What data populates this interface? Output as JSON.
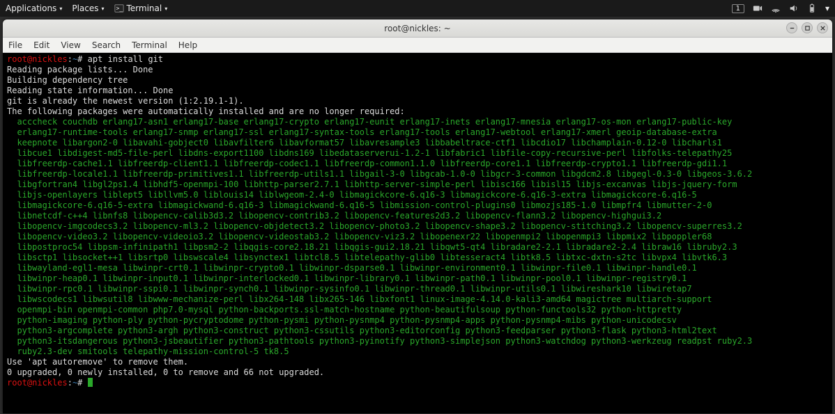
{
  "topbar": {
    "applications": "Applications",
    "places": "Places",
    "terminal": "Terminal",
    "workspace": "1"
  },
  "window": {
    "title": "root@nickles: ~"
  },
  "menubar": {
    "file": "File",
    "edit": "Edit",
    "view": "View",
    "search": "Search",
    "terminal": "Terminal",
    "help": "Help"
  },
  "prompt": {
    "userhost": "root@nickles",
    "sep": ":",
    "cwd": "~",
    "sigil": "#"
  },
  "term": {
    "cmd1": "apt install git",
    "l1": "Reading package lists... Done",
    "l2": "Building dependency tree",
    "l3": "Reading state information... Done",
    "l4": "git is already the newest version (1:2.19.1-1).",
    "l5": "The following packages were automatically installed and are no longer required:",
    "pkg": "  acccheck couchdb erlang17-asn1 erlang17-base erlang17-crypto erlang17-eunit erlang17-inets erlang17-mnesia erlang17-os-mon erlang17-public-key\n  erlang17-runtime-tools erlang17-snmp erlang17-ssl erlang17-syntax-tools erlang17-tools erlang17-webtool erlang17-xmerl geoip-database-extra\n  keepnote libargon2-0 libavahi-gobject0 libavfilter6 libavformat57 libavresample3 libbabeltrace-ctf1 libcdio17 libchamplain-0.12-0 libcharls1\n  libcue1 libdigest-md5-file-perl libdns-export1100 libdns169 libedataserverui-1.2-1 libfabric1 libfile-copy-recursive-perl libfolks-telepathy25\n  libfreerdp-cache1.1 libfreerdp-client1.1 libfreerdp-codec1.1 libfreerdp-common1.1.0 libfreerdp-core1.1 libfreerdp-crypto1.1 libfreerdp-gdi1.1\n  libfreerdp-locale1.1 libfreerdp-primitives1.1 libfreerdp-utils1.1 libgail-3-0 libgcab-1.0-0 libgcr-3-common libgdcm2.8 libgegl-0.3-0 libgeos-3.6.2\n  libgfortran4 libgl2ps1.4 libhdf5-openmpi-100 libhttp-parser2.7.1 libhttp-server-simple-perl libisc166 libisl15 libjs-excanvas libjs-jquery-form\n  libjs-openlayers liblept5 libllvm5.0 liblouis14 liblwgeom-2.4-0 libmagickcore-6.q16-3 libmagickcore-6.q16-3-extra libmagickcore-6.q16-5\n  libmagickcore-6.q16-5-extra libmagickwand-6.q16-3 libmagickwand-6.q16-5 libmission-control-plugins0 libmozjs185-1.0 libmpfr4 libmutter-2-0\n  libnetcdf-c++4 libnfs8 libopencv-calib3d3.2 libopencv-contrib3.2 libopencv-features2d3.2 libopencv-flann3.2 libopencv-highgui3.2\n  libopencv-imgcodecs3.2 libopencv-ml3.2 libopencv-objdetect3.2 libopencv-photo3.2 libopencv-shape3.2 libopencv-stitching3.2 libopencv-superres3.2\n  libopencv-video3.2 libopencv-videoio3.2 libopencv-videostab3.2 libopencv-viz3.2 libopenexr22 libopenmpi2 libopenmpi3 libpmix2 libpoppler68\n  libpostproc54 libpsm-infinipath1 libpsm2-2 libqgis-core2.18.21 libqgis-gui2.18.21 libqwt5-qt4 libradare2-2.1 libradare2-2.4 libraw16 libruby2.3\n  libsctp1 libsocket++1 libsrtp0 libswscale4 libsynctex1 libtcl8.5 libtelepathy-glib0 libtesseract4 libtk8.5 libtxc-dxtn-s2tc libvpx4 libvtk6.3\n  libwayland-egl1-mesa libwinpr-crt0.1 libwinpr-crypto0.1 libwinpr-dsparse0.1 libwinpr-environment0.1 libwinpr-file0.1 libwinpr-handle0.1\n  libwinpr-heap0.1 libwinpr-input0.1 libwinpr-interlocked0.1 libwinpr-library0.1 libwinpr-path0.1 libwinpr-pool0.1 libwinpr-registry0.1\n  libwinpr-rpc0.1 libwinpr-sspi0.1 libwinpr-synch0.1 libwinpr-sysinfo0.1 libwinpr-thread0.1 libwinpr-utils0.1 libwireshark10 libwiretap7\n  libwscodecs1 libwsutil8 libwww-mechanize-perl libx264-148 libx265-146 libxfont1 linux-image-4.14.0-kali3-amd64 magictree multiarch-support\n  openmpi-bin openmpi-common php7.0-mysql python-backports.ssl-match-hostname python-beautifulsoup python-functools32 python-httpretty\n  python-imaging python-ply python-pycryptodome python-pysmi python-pysnmp4 python-pysnmp4-apps python-pysnmp4-mibs python-unicodecsv\n  python3-argcomplete python3-argh python3-construct python3-cssutils python3-editorconfig python3-feedparser python3-flask python3-html2text\n  python3-itsdangerous python3-jsbeautifier python3-pathtools python3-pyinotify python3-simplejson python3-watchdog python3-werkzeug readpst ruby2.3\n  ruby2.3-dev smitools telepathy-mission-control-5 tk8.5",
    "l6": "Use 'apt autoremove' to remove them.",
    "l7": "0 upgraded, 0 newly installed, 0 to remove and 66 not upgraded."
  }
}
